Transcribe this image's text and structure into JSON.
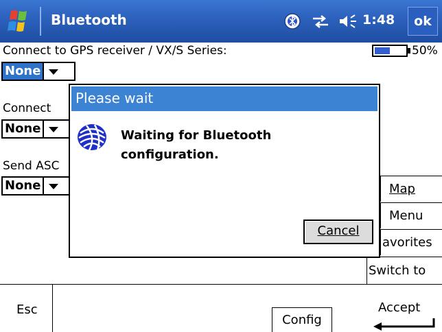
{
  "titlebar": {
    "title": "Bluetooth",
    "clock": "1:48",
    "ok_label": "ok",
    "icons": [
      "windows-start-icon",
      "bluetooth-tray-icon",
      "connectivity-icon",
      "volume-icon"
    ]
  },
  "form": {
    "gps_label": "Connect to GPS receiver / VX/S Series:",
    "gps_value": "None",
    "connect_label": "Connect",
    "connect_value": "None",
    "send_label": "Send ASC",
    "send_value": "None"
  },
  "status": {
    "battery_percent": "50%",
    "battery_level": 0.5
  },
  "side_menu": {
    "map": "Map",
    "menu": "Menu",
    "favorites": "avorites",
    "switch_to": "Switch to"
  },
  "bottom": {
    "esc": "Esc",
    "config": "Config",
    "accept": "Accept"
  },
  "dialog": {
    "title": "Please wait",
    "message_line1": "Waiting for Bluetooth",
    "message_line2": "configuration.",
    "cancel": "Cancel",
    "icon": "trimble-globe-icon"
  },
  "colors": {
    "titlebar": "#2b60bb",
    "dialog_title": "#3d83d4",
    "selection": "#2f72c9"
  }
}
